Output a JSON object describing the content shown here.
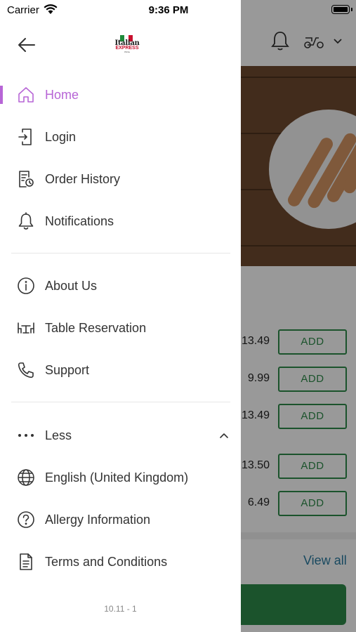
{
  "status_bar": {
    "carrier": "Carrier",
    "time": "9:36 PM"
  },
  "logo": {
    "line1": "Italian",
    "line2": "EXPRESS",
    "line3": "Pizza"
  },
  "menu_primary": [
    {
      "label": "Home",
      "icon": "home-icon",
      "active": true
    },
    {
      "label": "Login",
      "icon": "login-icon"
    },
    {
      "label": "Order History",
      "icon": "order-history-icon"
    },
    {
      "label": "Notifications",
      "icon": "bell-icon"
    }
  ],
  "menu_secondary": [
    {
      "label": "About Us",
      "icon": "info-icon"
    },
    {
      "label": "Table Reservation",
      "icon": "table-icon"
    },
    {
      "label": "Support",
      "icon": "phone-icon"
    }
  ],
  "menu_more": {
    "label": "Less",
    "icon": "more-dots-icon"
  },
  "menu_tertiary": [
    {
      "label": "English (United Kingdom)",
      "icon": "globe-icon"
    },
    {
      "label": "Allergy Information",
      "icon": "question-icon"
    },
    {
      "label": "Terms and Conditions",
      "icon": "document-icon"
    }
  ],
  "version": "10.11 - 1",
  "background": {
    "prices": [
      "13.49",
      "9.99",
      "13.49",
      "13.50",
      "6.49"
    ],
    "add_label": "ADD",
    "view_all": "View all"
  },
  "colors": {
    "accent": "#b765d6",
    "brand_green": "#2e8a4a",
    "link_blue": "#2a7ba0"
  }
}
